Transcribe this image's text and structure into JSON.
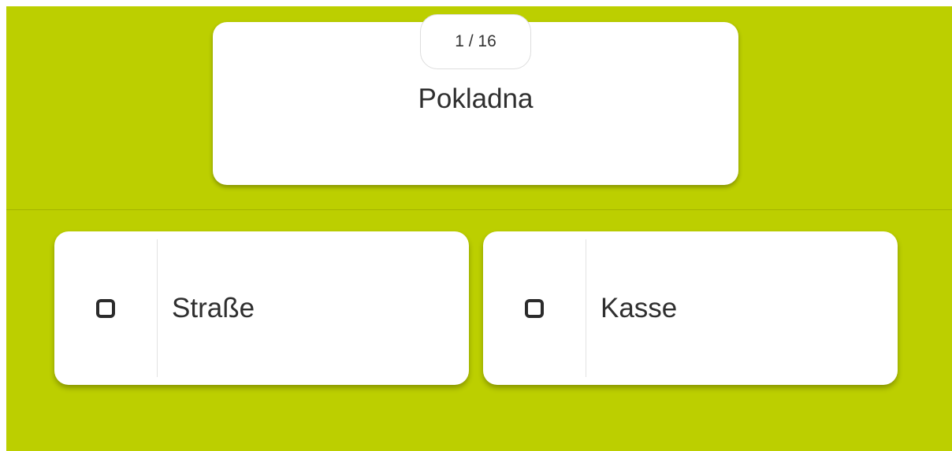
{
  "theme": {
    "background": "#bccf00",
    "card": "#ffffff",
    "text": "#2f2f2f"
  },
  "question": {
    "counter": "1 / 16",
    "word": "Pokladna"
  },
  "options": [
    {
      "label": "Straße",
      "icon": "checkbox-icon"
    },
    {
      "label": "Kasse",
      "icon": "checkbox-icon"
    }
  ]
}
